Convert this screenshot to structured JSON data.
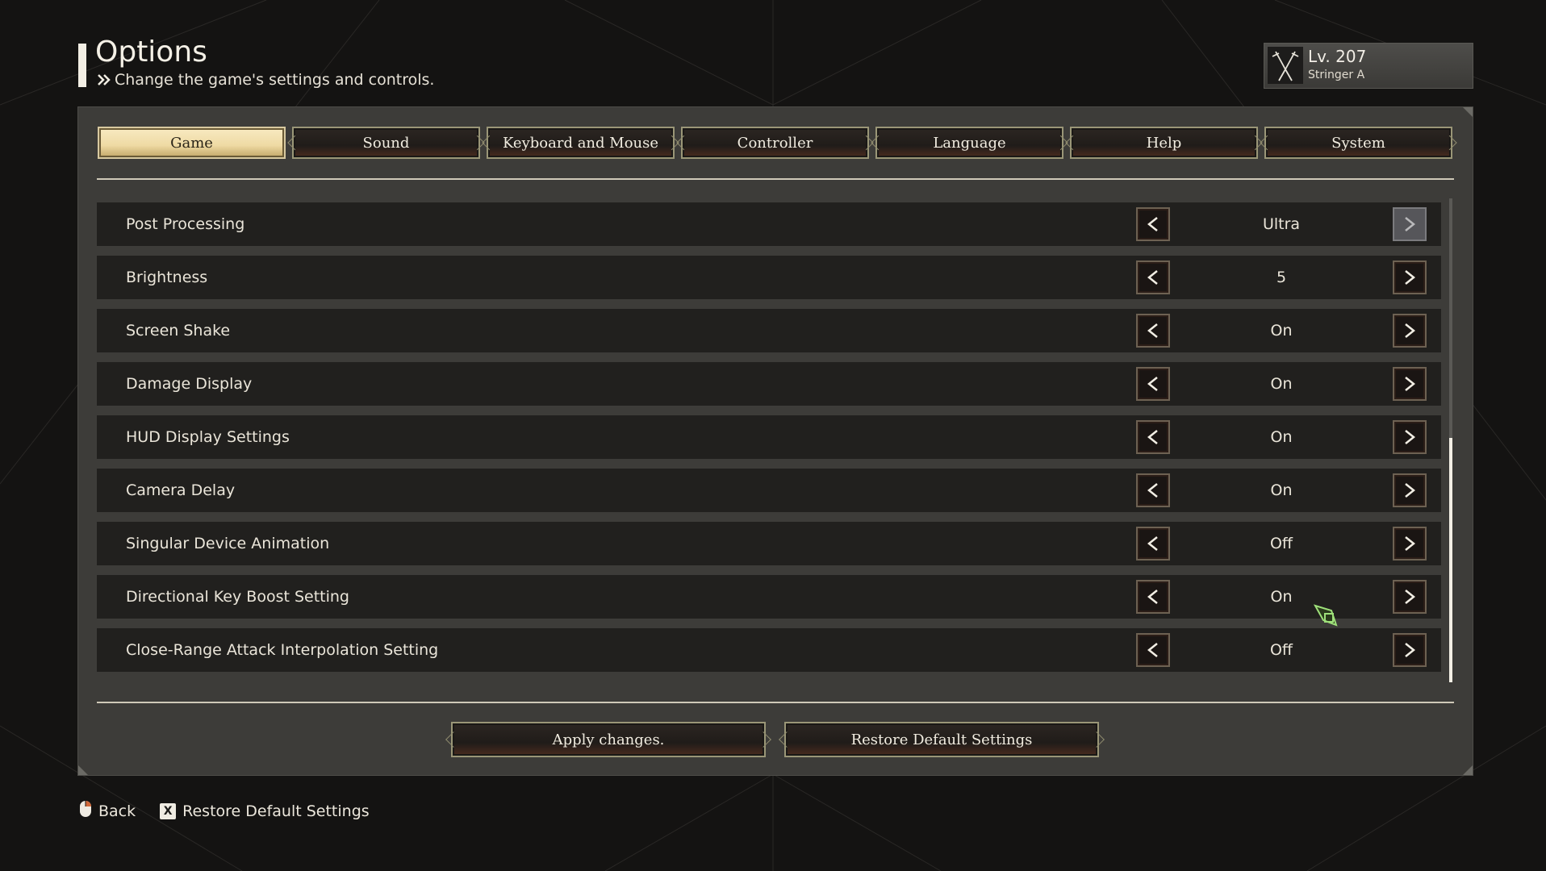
{
  "header": {
    "title": "Options",
    "subtitle": "Change the game's settings and controls."
  },
  "player": {
    "level": "Lv. 207",
    "class": "Stringer A"
  },
  "tabs": [
    {
      "label": "Game",
      "active": true
    },
    {
      "label": "Sound",
      "active": false
    },
    {
      "label": "Keyboard and Mouse",
      "active": false
    },
    {
      "label": "Controller",
      "active": false
    },
    {
      "label": "Language",
      "active": false
    },
    {
      "label": "Help",
      "active": false
    },
    {
      "label": "System",
      "active": false
    }
  ],
  "settings": [
    {
      "label": "Post Processing",
      "value": "Ultra"
    },
    {
      "label": "Brightness",
      "value": "5"
    },
    {
      "label": "Screen Shake",
      "value": "On"
    },
    {
      "label": "Damage Display",
      "value": "On"
    },
    {
      "label": "HUD Display Settings",
      "value": "On"
    },
    {
      "label": "Camera Delay",
      "value": "On"
    },
    {
      "label": "Singular Device Animation",
      "value": "Off"
    },
    {
      "label": "Directional Key Boost Setting",
      "value": "On"
    },
    {
      "label": "Close-Range Attack Interpolation Setting",
      "value": "Off"
    }
  ],
  "buttons": {
    "apply": "Apply changes.",
    "restore": "Restore Default Settings"
  },
  "footer": {
    "back": "Back",
    "restore_key": "X",
    "restore": "Restore Default Settings"
  },
  "icons": {
    "left_arrow": "chevron-left-icon",
    "right_arrow": "chevron-right-icon",
    "mouse": "mouse-icon",
    "cursor": "game-cursor-icon"
  },
  "colors": {
    "background": "#141312",
    "panel": "#3d3c39",
    "row": "#21201e",
    "active_tab": "#f3e2b0",
    "cursor": "#9ee07a"
  }
}
